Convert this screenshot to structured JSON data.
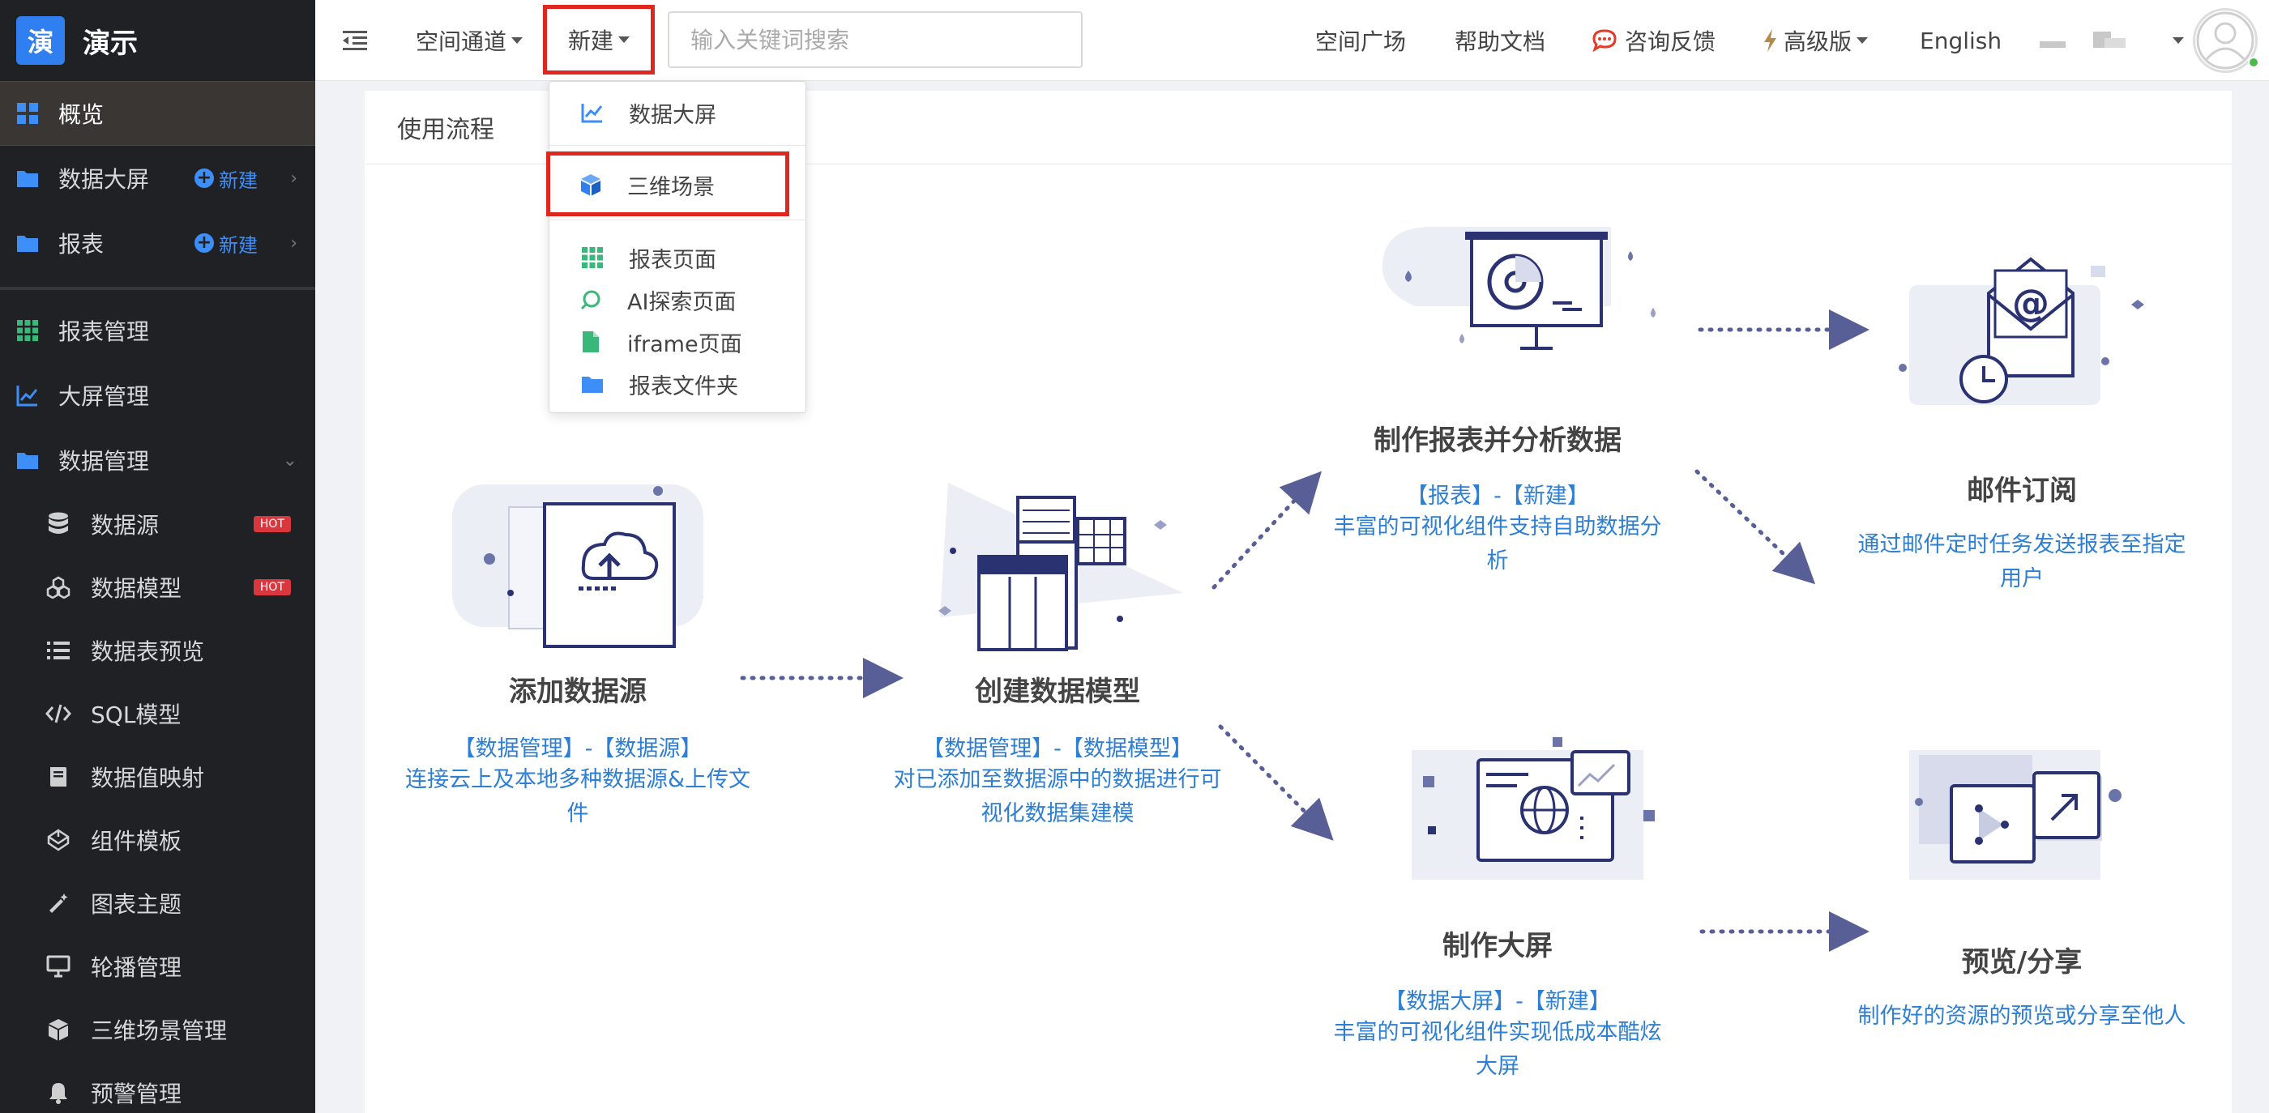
{
  "brand": {
    "logo_char": "演",
    "name": "演示"
  },
  "sidebar": {
    "top_items": [
      {
        "label": "概览"
      },
      {
        "label": "数据大屏",
        "new_label": "新建"
      },
      {
        "label": "报表",
        "new_label": "新建"
      }
    ],
    "items": [
      {
        "label": "报表管理"
      },
      {
        "label": "大屏管理"
      },
      {
        "label": "数据管理"
      }
    ],
    "sub_items": [
      {
        "label": "数据源",
        "badge": "HOT"
      },
      {
        "label": "数据模型",
        "badge": "HOT"
      },
      {
        "label": "数据表预览"
      },
      {
        "label": "SQL模型"
      },
      {
        "label": "数据值映射"
      },
      {
        "label": "组件模板"
      },
      {
        "label": "图表主题"
      },
      {
        "label": "轮播管理"
      },
      {
        "label": "三维场景管理"
      },
      {
        "label": "预警管理"
      }
    ]
  },
  "header": {
    "space_channel": "空间通道",
    "new_button": "新建",
    "search_placeholder": "输入关键词搜索",
    "space_square": "空间广场",
    "help_docs": "帮助文档",
    "feedback": "咨询反馈",
    "edition": "高级版",
    "language": "English"
  },
  "dropdown": {
    "items": [
      {
        "label": "数据大屏",
        "icon": "line-chart-icon"
      },
      {
        "label": "三维场景",
        "icon": "cube-icon"
      },
      {
        "label": "报表页面",
        "icon": "grid-icon"
      },
      {
        "label": "AI探索页面",
        "icon": "ai-icon"
      },
      {
        "label": "iframe页面",
        "icon": "file-icon"
      },
      {
        "label": "报表文件夹",
        "icon": "folder-icon"
      }
    ]
  },
  "main": {
    "panel_title": "使用流程",
    "steps": [
      {
        "title": "添加数据源",
        "tag": "【数据管理】-【数据源】",
        "desc_lines": [
          "连接云上及本地多种数据源&上传文",
          "件"
        ]
      },
      {
        "title": "创建数据模型",
        "tag": "【数据管理】-【数据模型】",
        "desc_lines": [
          "对已添加至数据源中的数据进行可",
          "视化数据集建模"
        ]
      },
      {
        "title": "制作报表并分析数据",
        "tag": "【报表】-【新建】",
        "desc_lines": [
          "丰富的可视化组件支持自助数据分",
          "析"
        ]
      },
      {
        "title": "邮件订阅",
        "tag": "",
        "desc_lines": [
          "通过邮件定时任务发送报表至指定",
          "用户"
        ]
      },
      {
        "title": "制作大屏",
        "tag": "【数据大屏】-【新建】",
        "desc_lines": [
          "丰富的可视化组件实现低成本酷炫",
          "大屏"
        ]
      },
      {
        "title": "预览/分享",
        "tag": "",
        "desc_lines": [
          "制作好的资源的预览或分享至他人"
        ]
      }
    ]
  },
  "colors": {
    "sidebar_bg": "#1f2125",
    "accent_blue": "#2f7ff0",
    "link_blue": "#2d7fd3",
    "highlight_red": "#e0271f",
    "illustration_navy": "#2b3272"
  }
}
